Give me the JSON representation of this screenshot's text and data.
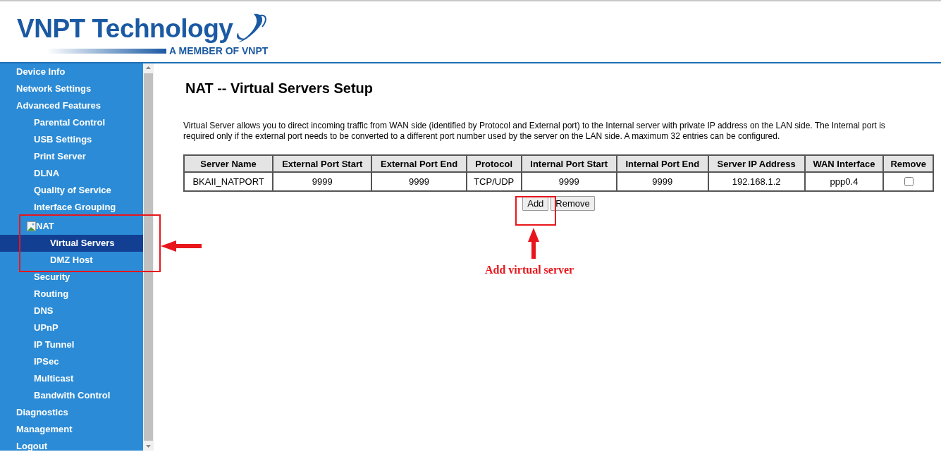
{
  "header": {
    "brand": "VNPT Technology",
    "tagline": "A MEMBER OF VNPT"
  },
  "sidebar": {
    "items": [
      {
        "label": "Device Info",
        "selected": false
      },
      {
        "label": "Network Settings",
        "selected": false
      },
      {
        "label": "Advanced Features",
        "selected": false,
        "children": [
          {
            "label": "Parental Control",
            "selected": false
          },
          {
            "label": "USB Settings",
            "selected": false
          },
          {
            "label": "Print Server",
            "selected": false
          },
          {
            "label": "DLNA",
            "selected": false
          },
          {
            "label": "Quality of Service",
            "selected": false
          },
          {
            "label": "Interface Grouping",
            "selected": false
          },
          {
            "label": "NAT",
            "selected": false,
            "broken_icon": true,
            "children": [
              {
                "label": "Virtual Servers",
                "selected": true
              },
              {
                "label": "DMZ Host",
                "selected": false
              }
            ]
          },
          {
            "label": "Security",
            "selected": false
          },
          {
            "label": "Routing",
            "selected": false
          },
          {
            "label": "DNS",
            "selected": false
          },
          {
            "label": "UPnP",
            "selected": false
          },
          {
            "label": "IP Tunnel",
            "selected": false
          },
          {
            "label": "IPSec",
            "selected": false
          },
          {
            "label": "Multicast",
            "selected": false
          },
          {
            "label": "Bandwith Control",
            "selected": false
          }
        ]
      },
      {
        "label": "Diagnostics",
        "selected": false
      },
      {
        "label": "Management",
        "selected": false
      },
      {
        "label": "Logout",
        "selected": false
      }
    ]
  },
  "page": {
    "title": "NAT -- Virtual Servers Setup",
    "description": "Virtual Server allows you to direct incoming traffic from WAN side (identified by Protocol and External port) to the Internal server with private IP address on the LAN side. The Internal port is required only if the external port needs to be converted to a different port number used by the server on the LAN side. A maximum 32 entries can be configured.",
    "table": {
      "columns": [
        "Server Name",
        "External Port Start",
        "External Port End",
        "Protocol",
        "Internal Port Start",
        "Internal Port End",
        "Server IP Address",
        "WAN Interface",
        "Remove"
      ],
      "rows": [
        {
          "cells": [
            "BKAII_NATPORT",
            "9999",
            "9999",
            "TCP/UDP",
            "9999",
            "9999",
            "192.168.1.2",
            "ppp0.4"
          ],
          "checked": false
        }
      ]
    },
    "buttons": [
      "Add",
      "Remove"
    ]
  },
  "annotation": {
    "text": "Add virtual server"
  }
}
